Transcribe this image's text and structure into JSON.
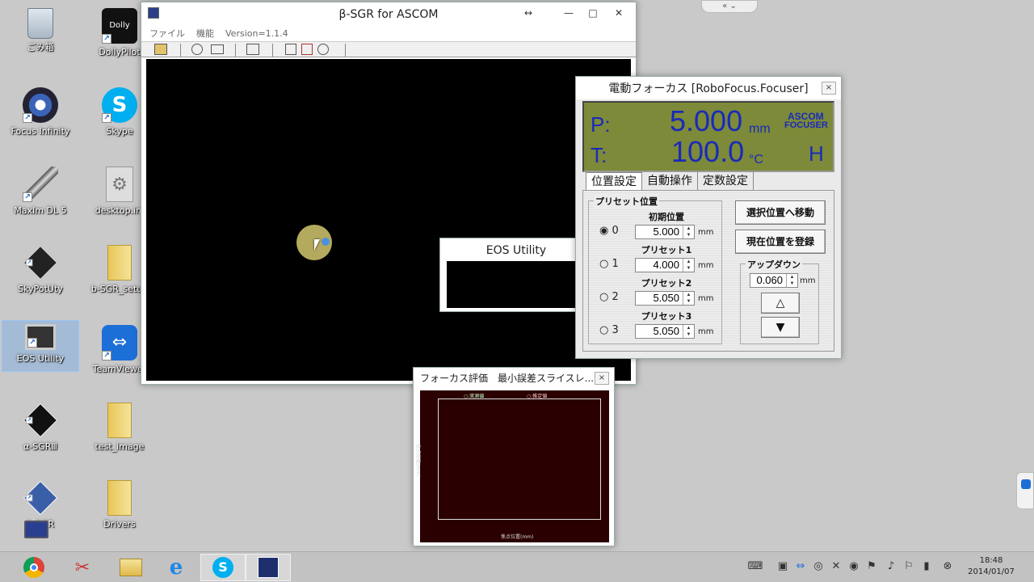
{
  "desktop": {
    "icons": [
      {
        "label": "ごみ箱"
      },
      {
        "label": "DollyPilot"
      },
      {
        "label": "Focus Infinity"
      },
      {
        "label": "Skype"
      },
      {
        "label": "MaxIm DL 5"
      },
      {
        "label": "desktop.ini"
      },
      {
        "label": "SkyPotUty"
      },
      {
        "label": "b-SGR_setup"
      },
      {
        "label": "EOS Utility"
      },
      {
        "label": "TeamViewer"
      },
      {
        "label": "α-SGRⅢ"
      },
      {
        "label": "test_image"
      },
      {
        "label": "β-SGR"
      },
      {
        "label": "Drivers"
      }
    ]
  },
  "main_window": {
    "title": "β-SGR for ASCOM",
    "menu": [
      "ファイル",
      "機能",
      "Version=1.1.4"
    ]
  },
  "focuser": {
    "title": "電動フォーカス [RoboFocus.Focuser]",
    "close": "×",
    "lcd": {
      "p_label": "P:",
      "p_value": "5.000",
      "p_unit": "mm",
      "t_label": "T:",
      "t_value": "100.0",
      "t_unit": "°C",
      "brand1": "ASCOM",
      "brand2": "FOCUSER",
      "mode": "H"
    },
    "tabs": [
      "位置設定",
      "自動操作",
      "定数設定"
    ],
    "preset_group": "プリセット位置",
    "presets": [
      {
        "radio": "0",
        "label": "初期位置",
        "value": "5.000",
        "unit": "mm",
        "selected": true
      },
      {
        "radio": "1",
        "label": "プリセット1",
        "value": "4.000",
        "unit": "mm",
        "selected": false
      },
      {
        "radio": "2",
        "label": "プリセット2",
        "value": "5.050",
        "unit": "mm",
        "selected": false
      },
      {
        "radio": "3",
        "label": "プリセット3",
        "value": "5.050",
        "unit": "mm",
        "selected": false
      }
    ],
    "move_button": "選択位置へ移動",
    "register_button": "現在位置を登録",
    "updown_group": "アップダウン",
    "updown_value": "0.060",
    "updown_unit": "mm",
    "up_glyph": "△",
    "down_glyph": "▼"
  },
  "eos_window": {
    "title": "EOS Utility"
  },
  "focus_eval": {
    "title": "フォーカス評価　最小誤差スライスレ...",
    "close": "×",
    "legend1": "○:実測値",
    "legend2": "○:推定値",
    "ylabel": "焦点距離(mm)",
    "xlabel": "焦点位置(mm)"
  },
  "taskbar": {
    "time": "18:48",
    "date": "2014/01/07"
  },
  "colors": {
    "lcd_bg": "#7c8a3a",
    "lcd_text": "#1a2ab8",
    "graph_bg": "#2a0000",
    "desktop_bg": "#c9c9c9"
  }
}
